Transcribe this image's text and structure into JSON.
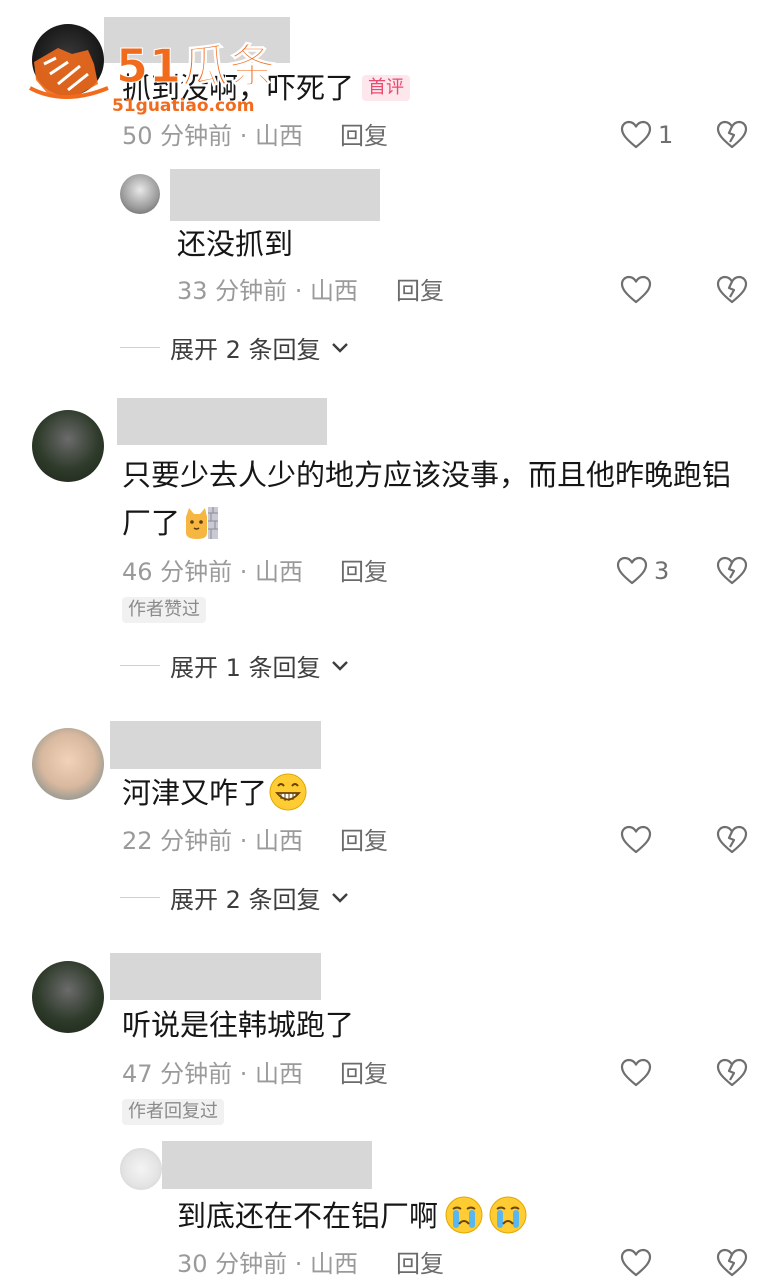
{
  "watermark": {
    "brand": "51瓜条",
    "domain": "51guatiao.com"
  },
  "colors": {
    "like": "#6f6f6f",
    "meta": "#9a9a9a",
    "mask": "#d7d7d7",
    "pin": "#e84b6f",
    "brand": "#f26b1d"
  },
  "comments": [
    {
      "text": "抓到没啊，吓死了",
      "badge": "首评",
      "time": "50 分钟前 · 山西",
      "reply": "回复",
      "likes": "1",
      "replies": [
        {
          "text": "还没抓到",
          "time": "33 分钟前 · 山西",
          "reply": "回复"
        }
      ],
      "expand": "展开 2 条回复"
    },
    {
      "text_line1": "只要少去人少的地方应该没事，而且他昨晚跑铝",
      "text_line2": "厂了",
      "time": "46 分钟前 · 山西",
      "reply": "回复",
      "likes": "3",
      "author_badge": "作者赞过",
      "expand": "展开 1 条回复"
    },
    {
      "text": "河津又咋了",
      "time": "22 分钟前 · 山西",
      "reply": "回复",
      "expand": "展开 2 条回复"
    },
    {
      "text": "听说是往韩城跑了",
      "time": "47 分钟前 · 山西",
      "reply": "回复",
      "author_badge": "作者回复过",
      "replies": [
        {
          "text": "到底还在不在铝厂啊",
          "time": "30 分钟前 · 山西",
          "reply": "回复"
        }
      ]
    }
  ]
}
